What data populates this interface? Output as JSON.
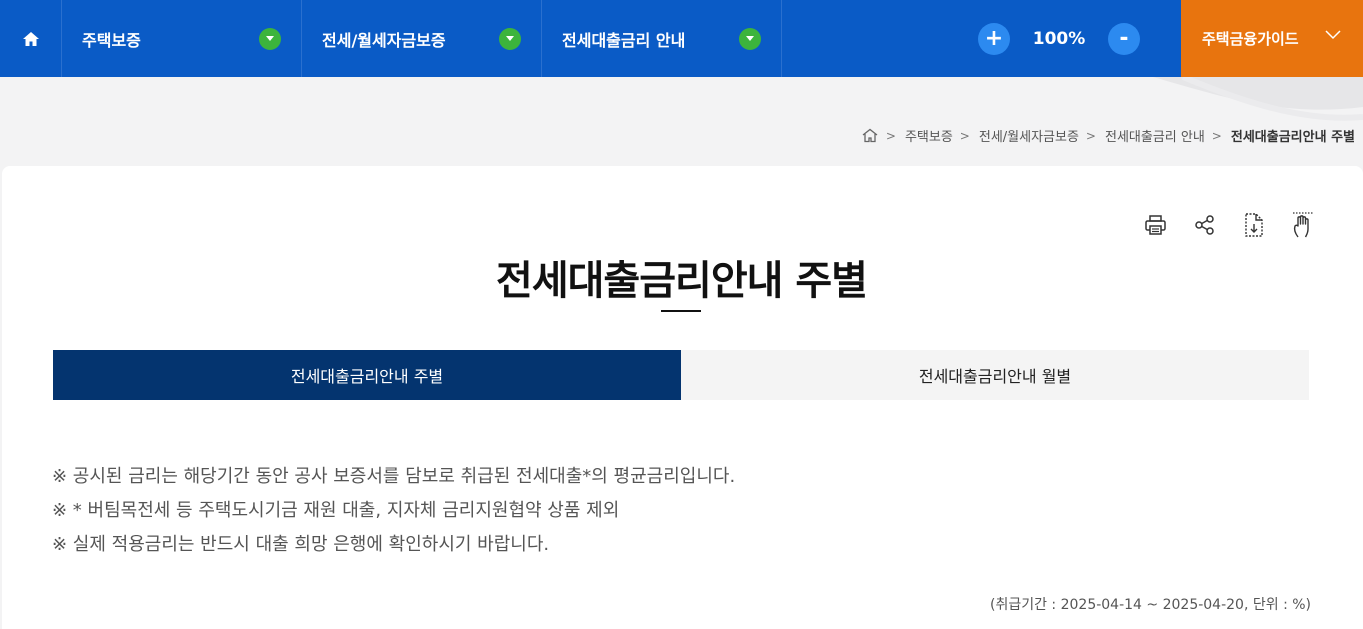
{
  "nav": {
    "items": [
      {
        "label": "주택보증"
      },
      {
        "label": "전세/월세자금보증"
      },
      {
        "label": "전세대출금리 안내"
      }
    ],
    "zoom_in": "+",
    "zoom_value": "100%",
    "zoom_out": "-",
    "guide_label": "주택금융가이드"
  },
  "breadcrumb": {
    "items": [
      "주택보증",
      "전세/월세자금보증",
      "전세대출금리 안내"
    ],
    "current": "전세대출금리안내 주별",
    "separator": ">"
  },
  "page": {
    "title": "전세대출금리안내 주별"
  },
  "tabs": [
    {
      "label": "전세대출금리안내 주별",
      "active": true
    },
    {
      "label": "전세대출금리안내 월별",
      "active": false
    }
  ],
  "notes": [
    "※ 공시된 금리는 해당기간 동안 공사 보증서를 담보로 취급된 전세대출*의 평균금리입니다.",
    "※ * 버팀목전세 등 주택도시기금 재원 대출, 지자체 금리지원협약 상품 제외",
    "※ 실제 적용금리는 반드시 대출 희망 은행에 확인하시기 바랍니다."
  ],
  "period": "(취급기간 : 2025-04-14 ~ 2025-04-20, 단위 : %)",
  "colors": {
    "nav_blue": "#0a5bc6",
    "guide_orange": "#e8740e",
    "tab_active": "#04346f",
    "arrow_green": "#3cb43c"
  }
}
